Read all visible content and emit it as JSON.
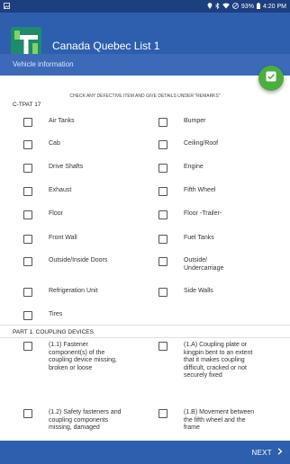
{
  "status": {
    "left_icon": "image-notification-icon",
    "battery": "93%",
    "time": "4:20 PM"
  },
  "app": {
    "title": "Canada Quebec List 1"
  },
  "section": {
    "title": "Vehicle information"
  },
  "instruction": "CHECK ANY DEFECTIVE ITEM AND GIVE DETAILS UNDER \"REMARKS\"",
  "groups": [
    {
      "title": "C-TPAT 17"
    },
    {
      "title": "PART 1. COUPLING DEVICES"
    }
  ],
  "items": [
    "Air Tanks",
    "Bumper",
    "Cab",
    "Ceiling/Roof",
    "Drive Shafts",
    "Engine",
    "Exhaust",
    "Fifth Wheel",
    "Floor",
    "Floor -Trailer-",
    "Front Wall",
    "Fuel Tanks",
    "Outside/Inside Doors",
    "Outside/ Undercarriage",
    "Refrigeration Unit",
    "Side Walls",
    "Tires"
  ],
  "coupling_items": [
    "(1.1) Fastener component(s) of the coupling device missing, broken or loose",
    "(1.A) Coupling plate or kingpin bent to an extent that it makes coupling difficult, cracked or not securely fixed",
    "(1.2) Safety fasteners and coupling components missing, damaged",
    "(1.B) Movement between the fifth wheel and the frame"
  ],
  "footer": {
    "next_label": "NEXT"
  },
  "colors": {
    "statusbar": "#1c3f80",
    "appbar": "#2d5fae",
    "section": "#3d6ab8",
    "fab": "#4cae3e"
  }
}
